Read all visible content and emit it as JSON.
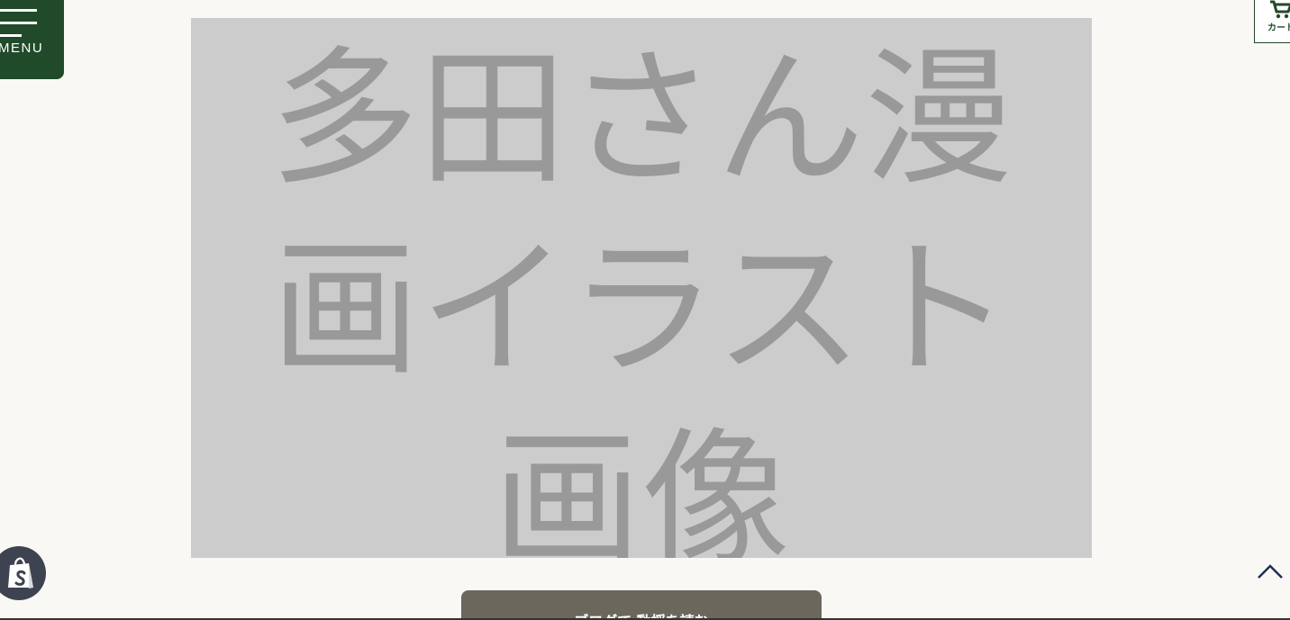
{
  "menu": {
    "label": "MENU"
  },
  "cart": {
    "label": "カート"
  },
  "hero": {
    "placeholder_text": "多田さん漫画イラスト画像"
  },
  "cta": {
    "label": "ブログで 動揺を読む"
  },
  "colors": {
    "brand_green": "#204a2a",
    "background": "#f9f8f4",
    "placeholder_bg": "#cccccc",
    "placeholder_text": "#999999",
    "cta_bg": "#6b675c",
    "shopify_badge": "#3d4350",
    "back_to_top_arrow": "#1f3050"
  },
  "icons": {
    "menu": "hamburger-icon",
    "cart": "shopping-cart-icon",
    "shopify": "shopify-bag-icon",
    "back_to_top": "chevron-up-icon"
  }
}
